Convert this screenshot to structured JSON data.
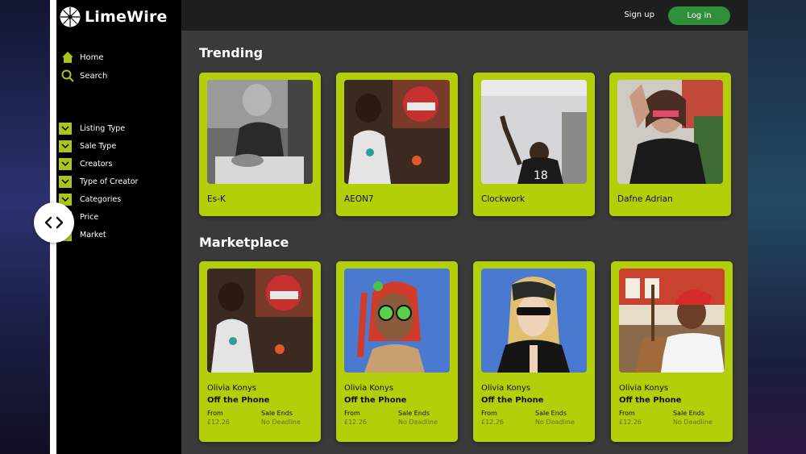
{
  "app": {
    "name": "LimeWire"
  },
  "header": {
    "signup_label": "Sign up",
    "login_label": "Log in"
  },
  "sidebar": {
    "nav": [
      {
        "label": "Home",
        "icon": "home-icon"
      },
      {
        "label": "Search",
        "icon": "search-icon"
      }
    ],
    "filters": [
      {
        "label": "Listing Type"
      },
      {
        "label": "Sale Type"
      },
      {
        "label": "Creators"
      },
      {
        "label": "Type of Creator"
      },
      {
        "label": "Categories"
      },
      {
        "label": "Price"
      },
      {
        "label": "Market"
      }
    ]
  },
  "trending": {
    "title": "Trending",
    "items": [
      {
        "name": "Es-K"
      },
      {
        "name": "AEON7"
      },
      {
        "name": "Clockwork"
      },
      {
        "name": "Dafne Adrian"
      }
    ]
  },
  "marketplace": {
    "title": "Marketplace",
    "items": [
      {
        "artist": "Olivia Konys",
        "title": "Off the Phone",
        "from_label": "From",
        "price": "£12.26",
        "sale_label": "Sale Ends",
        "sale_value": "No Deadline"
      },
      {
        "artist": "Olivia Konys",
        "title": "Off the Phone",
        "from_label": "From",
        "price": "£12.26",
        "sale_label": "Sale Ends",
        "sale_value": "No Deadline"
      },
      {
        "artist": "Olivia Konys",
        "title": "Off the Phone",
        "from_label": "From",
        "price": "£12.26",
        "sale_label": "Sale Ends",
        "sale_value": "No Deadline"
      },
      {
        "artist": "Olivia Konys",
        "title": "Off the Phone",
        "from_label": "From",
        "price": "£12.26",
        "sale_label": "Sale Ends",
        "sale_value": "No Deadline"
      }
    ]
  },
  "colors": {
    "accent": "#b2cf0a",
    "login": "#2f8f3b",
    "sidebar": "#000000",
    "content": "#3a3a3a"
  }
}
